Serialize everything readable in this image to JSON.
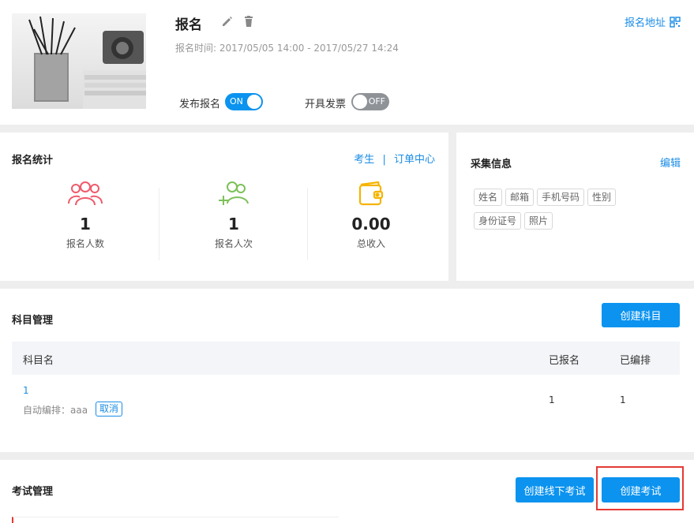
{
  "event": {
    "title": "报名",
    "time_text": "报名时间: 2017/05/05 14:00 - 2017/05/27 14:24",
    "address_link": "报名地址",
    "publish_label": "发布报名",
    "publish_toggle": "ON",
    "invoice_label": "开具发票",
    "invoice_toggle": "OFF"
  },
  "stats": {
    "title": "报名统计",
    "link_students": "考生",
    "link_separator": "|",
    "link_orders": "订单中心",
    "items": [
      {
        "value": "1",
        "label": "报名人数"
      },
      {
        "value": "1",
        "label": "报名人次"
      },
      {
        "value": "0.00",
        "label": "总收入"
      }
    ]
  },
  "collect": {
    "title": "采集信息",
    "edit": "编辑",
    "tags": [
      "姓名",
      "邮箱",
      "手机号码",
      "性别",
      "身份证号",
      "照片"
    ]
  },
  "subjects": {
    "title": "科目管理",
    "create_button": "创建科目",
    "columns": [
      "科目名",
      "已报名",
      "已编排"
    ],
    "rows": [
      {
        "name": "1",
        "auto_text": "自动编排：aaa",
        "cancel": "取消",
        "registered": "1",
        "arranged": "1"
      }
    ]
  },
  "exams": {
    "title": "考试管理",
    "offline_button": "创建线下考试",
    "create_button": "创建考试"
  },
  "colors": {
    "accent": "#0b93ef",
    "highlight": "#e53935",
    "pink": "#f05a6b",
    "green": "#7cc15a",
    "yellow": "#f5b400"
  }
}
